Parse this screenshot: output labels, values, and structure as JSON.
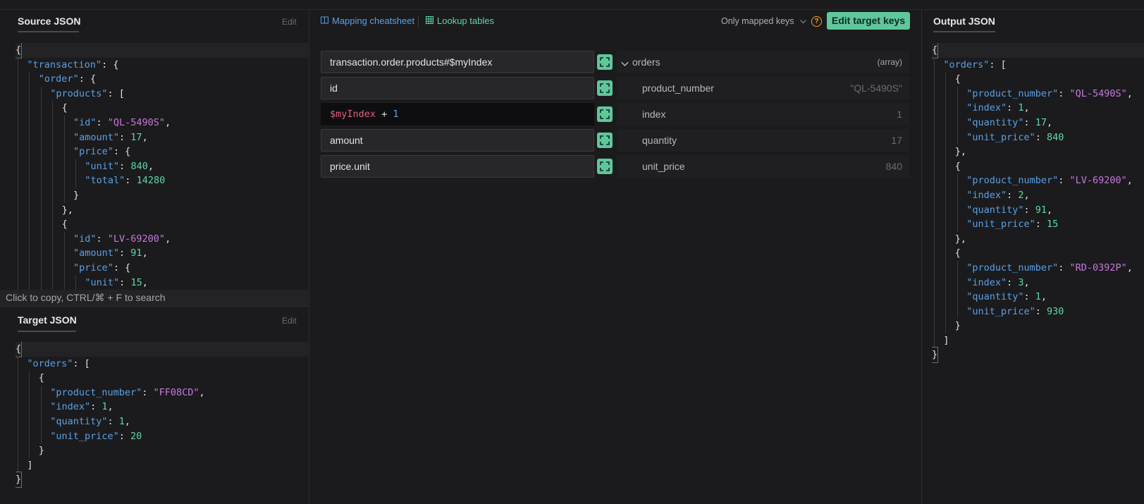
{
  "source_panel": {
    "title": "Source JSON",
    "edit_label": "Edit",
    "footer_hint": "Click to copy, CTRL/⌘ + F to search"
  },
  "target_panel": {
    "title": "Target JSON",
    "edit_label": "Edit"
  },
  "output_panel": {
    "title": "Output JSON"
  },
  "toolbar": {
    "mapping_cheatsheet": "Mapping cheatsheet",
    "lookup_tables": "Lookup tables",
    "only_mapped_keys": "Only mapped keys",
    "edit_target_keys": "Edit target keys",
    "help_glyph": "?"
  },
  "mapping_rows": [
    {
      "source": "transaction.order.products#$myIndex",
      "target_key": "orders",
      "target_value": "(array)"
    },
    {
      "source": "id",
      "target_key": "product_number",
      "target_value": "\"QL-5490S\""
    },
    {
      "source_var": "$myIndex",
      "source_op": " + ",
      "source_num": "1",
      "target_key": "index",
      "target_value": "1"
    },
    {
      "source": "amount",
      "target_key": "quantity",
      "target_value": "17"
    },
    {
      "source": "price.unit",
      "target_key": "unit_price",
      "target_value": "840"
    }
  ],
  "colors": {
    "background": "#1b1b1d",
    "json_key": "#5aa0e6",
    "json_string": "#c678dd",
    "json_number": "#5fd7a7",
    "accent_button": "#5fc79b",
    "help_icon": "#f5a623",
    "expression_variable": "#e0607a"
  },
  "icons": {
    "mapping_cheatsheet": "book-icon",
    "lookup_tables": "table-icon",
    "only_mapped_keys": "chevron-down-icon",
    "help": "question-circle-icon",
    "expand": "expand-icon",
    "orders_toggle": "chevron-down-icon"
  },
  "source_json_lines": [
    [
      {
        "t": "p",
        "v": "{"
      }
    ],
    [
      {
        "t": "k",
        "v": "\"transaction\""
      },
      {
        "t": "p",
        "v": ": {"
      }
    ],
    [
      {
        "t": "k",
        "v": "\"order\""
      },
      {
        "t": "p",
        "v": ": {"
      }
    ],
    [
      {
        "t": "k",
        "v": "\"products\""
      },
      {
        "t": "p",
        "v": ": ["
      }
    ],
    [
      {
        "t": "p",
        "v": "{"
      }
    ],
    [
      {
        "t": "k",
        "v": "\"id\""
      },
      {
        "t": "p",
        "v": ": "
      },
      {
        "t": "s",
        "v": "\"QL-5490S\""
      },
      {
        "t": "p",
        "v": ","
      }
    ],
    [
      {
        "t": "k",
        "v": "\"amount\""
      },
      {
        "t": "p",
        "v": ": "
      },
      {
        "t": "n",
        "v": "17"
      },
      {
        "t": "p",
        "v": ","
      }
    ],
    [
      {
        "t": "k",
        "v": "\"price\""
      },
      {
        "t": "p",
        "v": ": {"
      }
    ],
    [
      {
        "t": "k",
        "v": "\"unit\""
      },
      {
        "t": "p",
        "v": ": "
      },
      {
        "t": "n",
        "v": "840"
      },
      {
        "t": "p",
        "v": ","
      }
    ],
    [
      {
        "t": "k",
        "v": "\"total\""
      },
      {
        "t": "p",
        "v": ": "
      },
      {
        "t": "n",
        "v": "14280"
      }
    ],
    [
      {
        "t": "p",
        "v": "}"
      }
    ],
    [
      {
        "t": "p",
        "v": "},"
      }
    ],
    [
      {
        "t": "p",
        "v": "{"
      }
    ],
    [
      {
        "t": "k",
        "v": "\"id\""
      },
      {
        "t": "p",
        "v": ": "
      },
      {
        "t": "s",
        "v": "\"LV-69200\""
      },
      {
        "t": "p",
        "v": ","
      }
    ],
    [
      {
        "t": "k",
        "v": "\"amount\""
      },
      {
        "t": "p",
        "v": ": "
      },
      {
        "t": "n",
        "v": "91"
      },
      {
        "t": "p",
        "v": ","
      }
    ],
    [
      {
        "t": "k",
        "v": "\"price\""
      },
      {
        "t": "p",
        "v": ": {"
      }
    ],
    [
      {
        "t": "k",
        "v": "\"unit\""
      },
      {
        "t": "p",
        "v": ": "
      },
      {
        "t": "n",
        "v": "15"
      },
      {
        "t": "p",
        "v": ","
      }
    ]
  ],
  "target_json_lines": [
    [
      {
        "t": "p",
        "v": "{"
      }
    ],
    [
      {
        "t": "k",
        "v": "\"orders\""
      },
      {
        "t": "p",
        "v": ": ["
      }
    ],
    [
      {
        "t": "p",
        "v": "{"
      }
    ],
    [
      {
        "t": "k",
        "v": "\"product_number\""
      },
      {
        "t": "p",
        "v": ": "
      },
      {
        "t": "s",
        "v": "\"FF08CD\""
      },
      {
        "t": "p",
        "v": ","
      }
    ],
    [
      {
        "t": "k",
        "v": "\"index\""
      },
      {
        "t": "p",
        "v": ": "
      },
      {
        "t": "n",
        "v": "1"
      },
      {
        "t": "p",
        "v": ","
      }
    ],
    [
      {
        "t": "k",
        "v": "\"quantity\""
      },
      {
        "t": "p",
        "v": ": "
      },
      {
        "t": "n",
        "v": "1"
      },
      {
        "t": "p",
        "v": ","
      }
    ],
    [
      {
        "t": "k",
        "v": "\"unit_price\""
      },
      {
        "t": "p",
        "v": ": "
      },
      {
        "t": "n",
        "v": "20"
      }
    ],
    [
      {
        "t": "p",
        "v": "}"
      }
    ],
    [
      {
        "t": "p",
        "v": "]"
      }
    ],
    [
      {
        "t": "p",
        "v": "}"
      }
    ]
  ],
  "output_json_lines": [
    [
      {
        "t": "p",
        "v": "{"
      }
    ],
    [
      {
        "t": "k",
        "v": "\"orders\""
      },
      {
        "t": "p",
        "v": ": ["
      }
    ],
    [
      {
        "t": "p",
        "v": "{"
      }
    ],
    [
      {
        "t": "k",
        "v": "\"product_number\""
      },
      {
        "t": "p",
        "v": ": "
      },
      {
        "t": "s",
        "v": "\"QL-5490S\""
      },
      {
        "t": "p",
        "v": ","
      }
    ],
    [
      {
        "t": "k",
        "v": "\"index\""
      },
      {
        "t": "p",
        "v": ": "
      },
      {
        "t": "n",
        "v": "1"
      },
      {
        "t": "p",
        "v": ","
      }
    ],
    [
      {
        "t": "k",
        "v": "\"quantity\""
      },
      {
        "t": "p",
        "v": ": "
      },
      {
        "t": "n",
        "v": "17"
      },
      {
        "t": "p",
        "v": ","
      }
    ],
    [
      {
        "t": "k",
        "v": "\"unit_price\""
      },
      {
        "t": "p",
        "v": ": "
      },
      {
        "t": "n",
        "v": "840"
      }
    ],
    [
      {
        "t": "p",
        "v": "},"
      }
    ],
    [
      {
        "t": "p",
        "v": "{"
      }
    ],
    [
      {
        "t": "k",
        "v": "\"product_number\""
      },
      {
        "t": "p",
        "v": ": "
      },
      {
        "t": "s",
        "v": "\"LV-69200\""
      },
      {
        "t": "p",
        "v": ","
      }
    ],
    [
      {
        "t": "k",
        "v": "\"index\""
      },
      {
        "t": "p",
        "v": ": "
      },
      {
        "t": "n",
        "v": "2"
      },
      {
        "t": "p",
        "v": ","
      }
    ],
    [
      {
        "t": "k",
        "v": "\"quantity\""
      },
      {
        "t": "p",
        "v": ": "
      },
      {
        "t": "n",
        "v": "91"
      },
      {
        "t": "p",
        "v": ","
      }
    ],
    [
      {
        "t": "k",
        "v": "\"unit_price\""
      },
      {
        "t": "p",
        "v": ": "
      },
      {
        "t": "n",
        "v": "15"
      }
    ],
    [
      {
        "t": "p",
        "v": "},"
      }
    ],
    [
      {
        "t": "p",
        "v": "{"
      }
    ],
    [
      {
        "t": "k",
        "v": "\"product_number\""
      },
      {
        "t": "p",
        "v": ": "
      },
      {
        "t": "s",
        "v": "\"RD-0392P\""
      },
      {
        "t": "p",
        "v": ","
      }
    ],
    [
      {
        "t": "k",
        "v": "\"index\""
      },
      {
        "t": "p",
        "v": ": "
      },
      {
        "t": "n",
        "v": "3"
      },
      {
        "t": "p",
        "v": ","
      }
    ],
    [
      {
        "t": "k",
        "v": "\"quantity\""
      },
      {
        "t": "p",
        "v": ": "
      },
      {
        "t": "n",
        "v": "1"
      },
      {
        "t": "p",
        "v": ","
      }
    ],
    [
      {
        "t": "k",
        "v": "\"unit_price\""
      },
      {
        "t": "p",
        "v": ": "
      },
      {
        "t": "n",
        "v": "930"
      }
    ],
    [
      {
        "t": "p",
        "v": "}"
      }
    ],
    [
      {
        "t": "p",
        "v": "]"
      }
    ],
    [
      {
        "t": "p",
        "v": "}"
      }
    ]
  ]
}
